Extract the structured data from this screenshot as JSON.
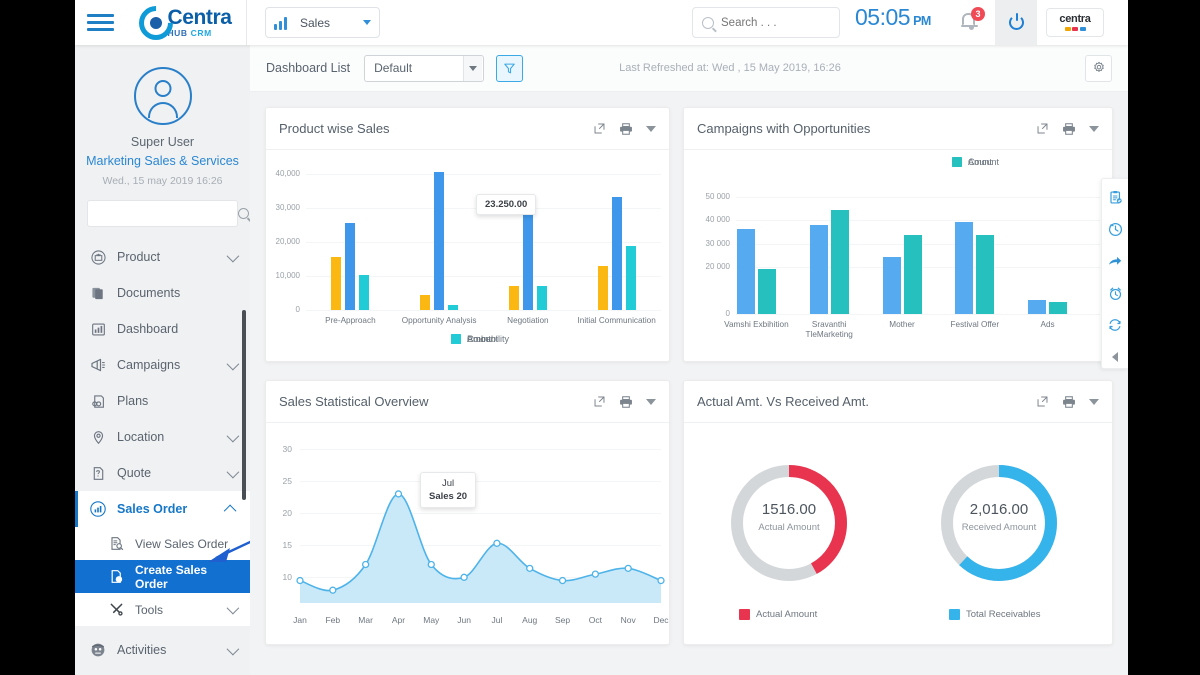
{
  "topbar": {
    "menu_icon": "hamburger-icon",
    "logo": {
      "name": "Centra",
      "sub_a": "HUB",
      "sub_b": "CRM"
    },
    "module": {
      "label": "Sales",
      "icon": "bar-chart-icon"
    },
    "search": {
      "placeholder": "Search . . .",
      "value": ""
    },
    "clock": {
      "time": "05:05",
      "ampm": "PM"
    },
    "notifications": {
      "count": "3",
      "icon": "bell-icon"
    },
    "power_icon": "power-icon",
    "brand_chip": {
      "text": "centra"
    }
  },
  "sidebar": {
    "user": {
      "name": "Super User",
      "role": "Marketing Sales & Services",
      "date": "Wed., 15 may 2019 16:26"
    },
    "search": {
      "placeholder": "",
      "value": ""
    },
    "items": [
      {
        "label": "Product",
        "icon": "product-icon",
        "chevron": "down",
        "active": false
      },
      {
        "label": "Documents",
        "icon": "documents-icon",
        "chevron": "",
        "active": false
      },
      {
        "label": "Dashboard",
        "icon": "dashboard-icon",
        "chevron": "",
        "active": false
      },
      {
        "label": "Campaigns",
        "icon": "campaigns-icon",
        "chevron": "down",
        "active": false
      },
      {
        "label": "Plans",
        "icon": "plans-icon",
        "chevron": "",
        "active": false
      },
      {
        "label": "Location",
        "icon": "location-icon",
        "chevron": "down",
        "active": false
      },
      {
        "label": "Quote",
        "icon": "quote-icon",
        "chevron": "down",
        "active": false
      },
      {
        "label": "Sales Order",
        "icon": "sales-order-icon",
        "chevron": "up",
        "active": true
      }
    ],
    "sub_items": [
      {
        "label": "View Sales Order",
        "icon": "view-order-icon",
        "selected": false
      },
      {
        "label": "Create Sales Order",
        "icon": "create-order-icon",
        "selected": true
      },
      {
        "label": "Tools",
        "icon": "tools-icon",
        "selected": false,
        "chevron": "down"
      }
    ],
    "bottom_items": [
      {
        "label": "Activities",
        "icon": "activities-icon",
        "chevron": "down"
      }
    ]
  },
  "toolbar": {
    "dashboard_list_label": "Dashboard List",
    "dashboard_select": {
      "value": "Default",
      "options": [
        "Default"
      ]
    },
    "filter_icon": "funnel-icon",
    "last_refreshed": "Last Refreshed at: Wed , 15 May 2019, 16:26",
    "settings_icon": "gear-icon"
  },
  "cards": {
    "product": {
      "title": "Product wise Sales",
      "actions": [
        "expand-icon",
        "print-icon",
        "chevron-down-icon"
      ]
    },
    "campaigns": {
      "title": "Campaigns with Opportunities",
      "actions": [
        "expand-icon",
        "print-icon",
        "chevron-down-icon"
      ]
    },
    "sales": {
      "title": "Sales Statistical Overview",
      "actions": [
        "expand-icon",
        "print-icon",
        "chevron-down-icon"
      ]
    },
    "actual": {
      "title": "Actual Amt. Vs Received Amt.",
      "actions": [
        "expand-icon",
        "print-icon",
        "chevron-down-icon"
      ]
    }
  },
  "right_rail": {
    "items": [
      "task-clipboard-icon",
      "history-clock-icon",
      "share-arrow-icon",
      "alarm-clock-icon",
      "sync-refresh-icon"
    ],
    "collapse_icon": "collapse-left-icon"
  },
  "colors": {
    "probability": "#FBB812",
    "amount": "#3E97EB",
    "count": "#21CCD6",
    "campaign_amount": "#55AAF0",
    "campaign_count": "#26C0BE",
    "actual": "#E8344E",
    "receivable": "#35B4EC",
    "track": "#D4D7D9",
    "accent_blue": "#1677c7",
    "area_fill": "#BFE5F8",
    "area_line": "#4EB3E8"
  },
  "chart_data": [
    {
      "id": "product-wise-sales",
      "type": "bar",
      "title": "Product wise Sales",
      "categories": [
        "Pre-Approach",
        "Opportunity Analysis",
        "Negotiation",
        "Initial Communication"
      ],
      "series": [
        {
          "name": "Probability",
          "color": "#FBB812",
          "values": [
            15500,
            4500,
            7000,
            13000
          ]
        },
        {
          "name": "Amount",
          "color": "#3E97EB",
          "values": [
            25700,
            40700,
            27900,
            33200
          ]
        },
        {
          "name": "Count",
          "color": "#21CCD6",
          "values": [
            10200,
            1500,
            7000,
            19000
          ]
        }
      ],
      "ylim": [
        0,
        43000
      ],
      "yticks": [
        0,
        10000,
        20000,
        30000,
        40000
      ],
      "ytick_labels": [
        "0",
        "10,000",
        "20,000",
        "30,000",
        "40,000"
      ],
      "xlabel": "",
      "ylabel": "",
      "grid": true,
      "legend_position": "bottom",
      "tooltip": {
        "text": "23.250.00",
        "series": "Amount",
        "category": "Negotiation"
      }
    },
    {
      "id": "campaigns-with-opportunities",
      "type": "bar",
      "title": "Campaigns with Opportunities",
      "categories": [
        "Vamshi Exbihition",
        "Sravanthi TleMarketing",
        "Mother",
        "Festival Offer",
        "Ads"
      ],
      "series": [
        {
          "name": "Amount",
          "color": "#55AAF0",
          "values": [
            36200,
            37800,
            24100,
            39300,
            5900
          ]
        },
        {
          "name": "Count",
          "color": "#26C0BE",
          "values": [
            19100,
            44300,
            33600,
            33600,
            5300
          ]
        }
      ],
      "ylim": [
        0,
        52000
      ],
      "yticks": [
        0,
        20000,
        30000,
        40000,
        50000
      ],
      "ytick_labels": [
        "0",
        "20 000",
        "30 000",
        "40 000",
        "50 000"
      ],
      "xlabel": "",
      "ylabel": "",
      "grid": true,
      "legend_position": "top-right"
    },
    {
      "id": "sales-statistical-overview",
      "type": "area",
      "title": "Sales Statistical Overview",
      "categories": [
        "Jan",
        "Feb",
        "Mar",
        "Apr",
        "May",
        "Jun",
        "Jul",
        "Aug",
        "Sep",
        "Oct",
        "Nov",
        "Dec"
      ],
      "series": [
        {
          "name": "Sales",
          "color": "#4EB3E8",
          "values": [
            9.5,
            8,
            12,
            23,
            12,
            10,
            15.3,
            11.4,
            9.5,
            10.5,
            11.4,
            9.5
          ]
        }
      ],
      "ylim": [
        6,
        30
      ],
      "yticks": [
        10,
        15,
        20,
        25,
        30
      ],
      "ytick_labels": [
        "10",
        "15",
        "20",
        "25",
        "30"
      ],
      "xlabel": "",
      "ylabel": "",
      "grid": true,
      "legend_position": "none",
      "tooltip": {
        "line1": "Jul",
        "line2": "Sales 20"
      }
    },
    {
      "id": "actual-vs-received",
      "type": "pie",
      "title": "Actual Amt. Vs Received Amt.",
      "donuts": [
        {
          "value": "1516.00",
          "caption": "Actual Amount",
          "legend": "Actual Amount",
          "color": "#E8344E",
          "track": "#D4D7D9",
          "percent": 42
        },
        {
          "value": "2,016.00",
          "caption": "Received Amount",
          "legend": "Total Receivables",
          "color": "#35B4EC",
          "track": "#D4D7D9",
          "percent": 62
        }
      ]
    }
  ]
}
